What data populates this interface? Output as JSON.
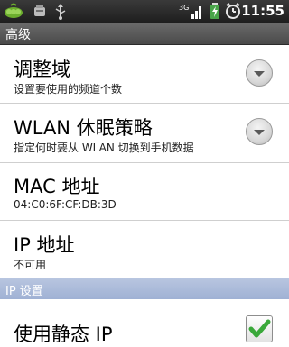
{
  "status_bar": {
    "time": "11:55",
    "icons": [
      "android-pea-icon",
      "notification-icon",
      "usb-icon",
      "3g-signal-icon",
      "battery-charging-icon",
      "alarm-icon"
    ],
    "network_label": "3G"
  },
  "header": {
    "title": "高级"
  },
  "preferences": [
    {
      "title": "调整域",
      "summary": "设置要使用的频道个数",
      "control": "spinner"
    },
    {
      "title": "WLAN 休眠策略",
      "summary": "指定何时要从 WLAN 切换到手机数据",
      "control": "spinner"
    },
    {
      "title": "MAC 地址",
      "summary": "04:C0:6F:CF:DB:3D",
      "control": "none"
    },
    {
      "title": "IP 地址",
      "summary": "不可用",
      "control": "none"
    }
  ],
  "ip_section": {
    "header": "IP 设置",
    "static_ip": {
      "title": "使用静态 IP",
      "checked": true
    }
  },
  "colors": {
    "status_bar": "#2b2b2b",
    "title_bar": "#5a5a5a",
    "section_header": "#a9b9d9",
    "check_green": "#3aa83a"
  }
}
